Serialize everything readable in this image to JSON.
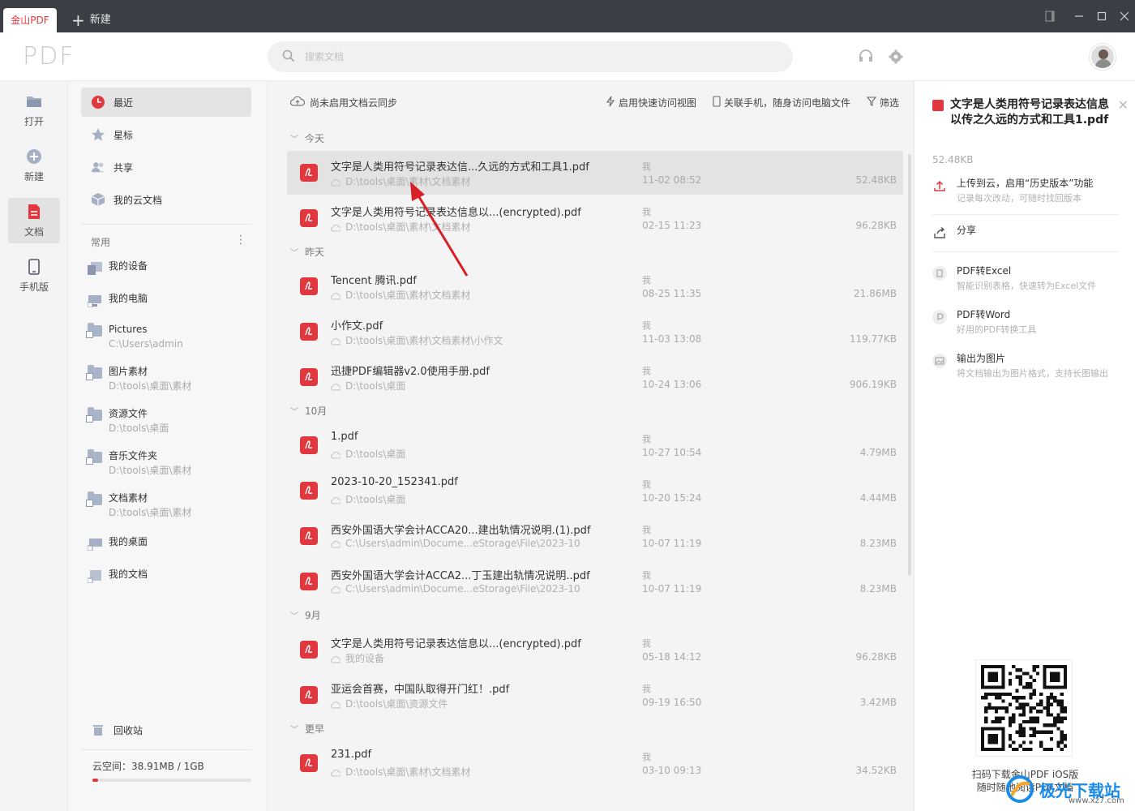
{
  "titlebar": {
    "app_tab": "金山PDF",
    "new_tab": "新建"
  },
  "header": {
    "logo": "PDF",
    "search_placeholder": "搜索文档"
  },
  "rail": {
    "items": [
      {
        "label": "打开",
        "icon": "folder-open-icon"
      },
      {
        "label": "新建",
        "icon": "plus-circle-icon"
      },
      {
        "label": "文档",
        "icon": "document-icon",
        "active": true
      },
      {
        "label": "手机版",
        "icon": "phone-icon"
      }
    ]
  },
  "sidebar": {
    "top": [
      {
        "label": "最近",
        "icon": "clock-icon",
        "active": true
      },
      {
        "label": "星标",
        "icon": "star-icon"
      },
      {
        "label": "共享",
        "icon": "users-icon"
      },
      {
        "label": "我的云文档",
        "icon": "cloud-box-icon"
      }
    ],
    "section_title": "常用",
    "locations": [
      {
        "name": "我的设备",
        "path": ""
      },
      {
        "name": "我的电脑",
        "path": ""
      },
      {
        "name": "Pictures",
        "path": "C:\\Users\\admin"
      },
      {
        "name": "图片素材",
        "path": "D:\\tools\\桌面\\素材"
      },
      {
        "name": "资源文件",
        "path": "D:\\tools\\桌面"
      },
      {
        "name": "音乐文件夹",
        "path": "D:\\tools\\桌面\\素材"
      },
      {
        "name": "文档素材",
        "path": "D:\\tools\\桌面\\素材"
      },
      {
        "name": "我的桌面",
        "path": ""
      },
      {
        "name": "我的文档",
        "path": ""
      }
    ],
    "recycle": "回收站",
    "storage": "云空间：38.91MB / 1GB",
    "storage_used_fraction": 0.038
  },
  "main": {
    "sync_notice": "尚未启用文档云同步",
    "toolbar": {
      "quick_view": "启用快速访问视图",
      "phone_link": "关联手机，随身访问电脑文件",
      "filter": "筛选"
    },
    "groups": [
      "今天",
      "昨天",
      "10月",
      "9月",
      "更早"
    ],
    "files": [
      {
        "name": "文字是人类用符号记录表达信...久远的方式和工具1.pdf",
        "path": "D:\\tools\\桌面\\素材\\文档素材",
        "owner": "我",
        "time": "11-02 08:52",
        "size": "52.48KB"
      },
      {
        "name": "文字是人类用符号记录表达信息以...(encrypted).pdf",
        "path": "D:\\tools\\桌面\\素材\\文档素材",
        "owner": "我",
        "time": "02-15 11:23",
        "size": "96.28KB"
      },
      {
        "name": "Tencent 腾讯.pdf",
        "path": "D:\\tools\\桌面\\素材\\文档素材",
        "owner": "我",
        "time": "08-25 11:35",
        "size": "21.86MB"
      },
      {
        "name": "小作文.pdf",
        "path": "D:\\tools\\桌面\\素材\\文档素材\\小作文",
        "owner": "我",
        "time": "11-03 13:08",
        "size": "119.77KB"
      },
      {
        "name": "迅捷PDF编辑器v2.0使用手册.pdf",
        "path": "D:\\tools\\桌面",
        "owner": "我",
        "time": "10-24 13:06",
        "size": "906.19KB"
      },
      {
        "name": "1.pdf",
        "path": "D:\\tools\\桌面",
        "owner": "我",
        "time": "10-27 10:54",
        "size": "4.79MB"
      },
      {
        "name": "2023-10-20_152341.pdf",
        "path": "D:\\tools\\桌面",
        "owner": "我",
        "time": "10-20 15:24",
        "size": "4.44MB"
      },
      {
        "name": "西安外国语大学会计ACCA20...建出轨情况说明.(1).pdf",
        "path": "C:\\Users\\admin\\Docume...eStorage\\File\\2023-10",
        "owner": "我",
        "time": "10-07 11:19",
        "size": "8.23MB"
      },
      {
        "name": "西安外国语大学会计ACCA2...丁玉建出轨情况说明..pdf",
        "path": "C:\\Users\\admin\\Docume...eStorage\\File\\2023-10",
        "owner": "我",
        "time": "10-07 11:19",
        "size": "8.23MB"
      },
      {
        "name": "文字是人类用符号记录表达信息以...(encrypted).pdf",
        "path": "我的设备",
        "owner": "我",
        "time": "05-18 14:12",
        "size": "96.28KB"
      },
      {
        "name": "亚运会首赛，中国队取得开门红！.pdf",
        "path": "D:\\tools\\桌面\\资源文件",
        "owner": "我",
        "time": "09-19 16:50",
        "size": "3.42MB"
      },
      {
        "name": "231.pdf",
        "path": "D:\\tools\\桌面\\素材\\文档素材",
        "owner": "我",
        "time": "03-10 09:13",
        "size": "34.52KB"
      }
    ]
  },
  "panel": {
    "title": "文字是人类用符号记录表达信息以传之久远的方式和工具1.pdf",
    "size": "52.48KB",
    "upload_title": "上传到云，启用“历史版本”功能",
    "upload_sub": "记录每次改动，可随时找回版本",
    "share": "分享",
    "tools": [
      {
        "title": "PDF转Excel",
        "sub": "智能识别表格，快速转为Excel文件"
      },
      {
        "title": "PDF转Word",
        "sub": "好用的PDF转换工具"
      },
      {
        "title": "输出为图片",
        "sub": "将文档输出为图片格式，支持长图输出"
      }
    ],
    "qr_caption_1": "扫码下载金山PDF iOS版",
    "qr_caption_2": "随时随地阅读PDF文档"
  },
  "watermark": {
    "text": "极光下载站",
    "sub": "www.xz7.com"
  },
  "colors": {
    "accent": "#e0383e",
    "titlebar": "#3b3e45",
    "arrow": "#d61f26"
  }
}
